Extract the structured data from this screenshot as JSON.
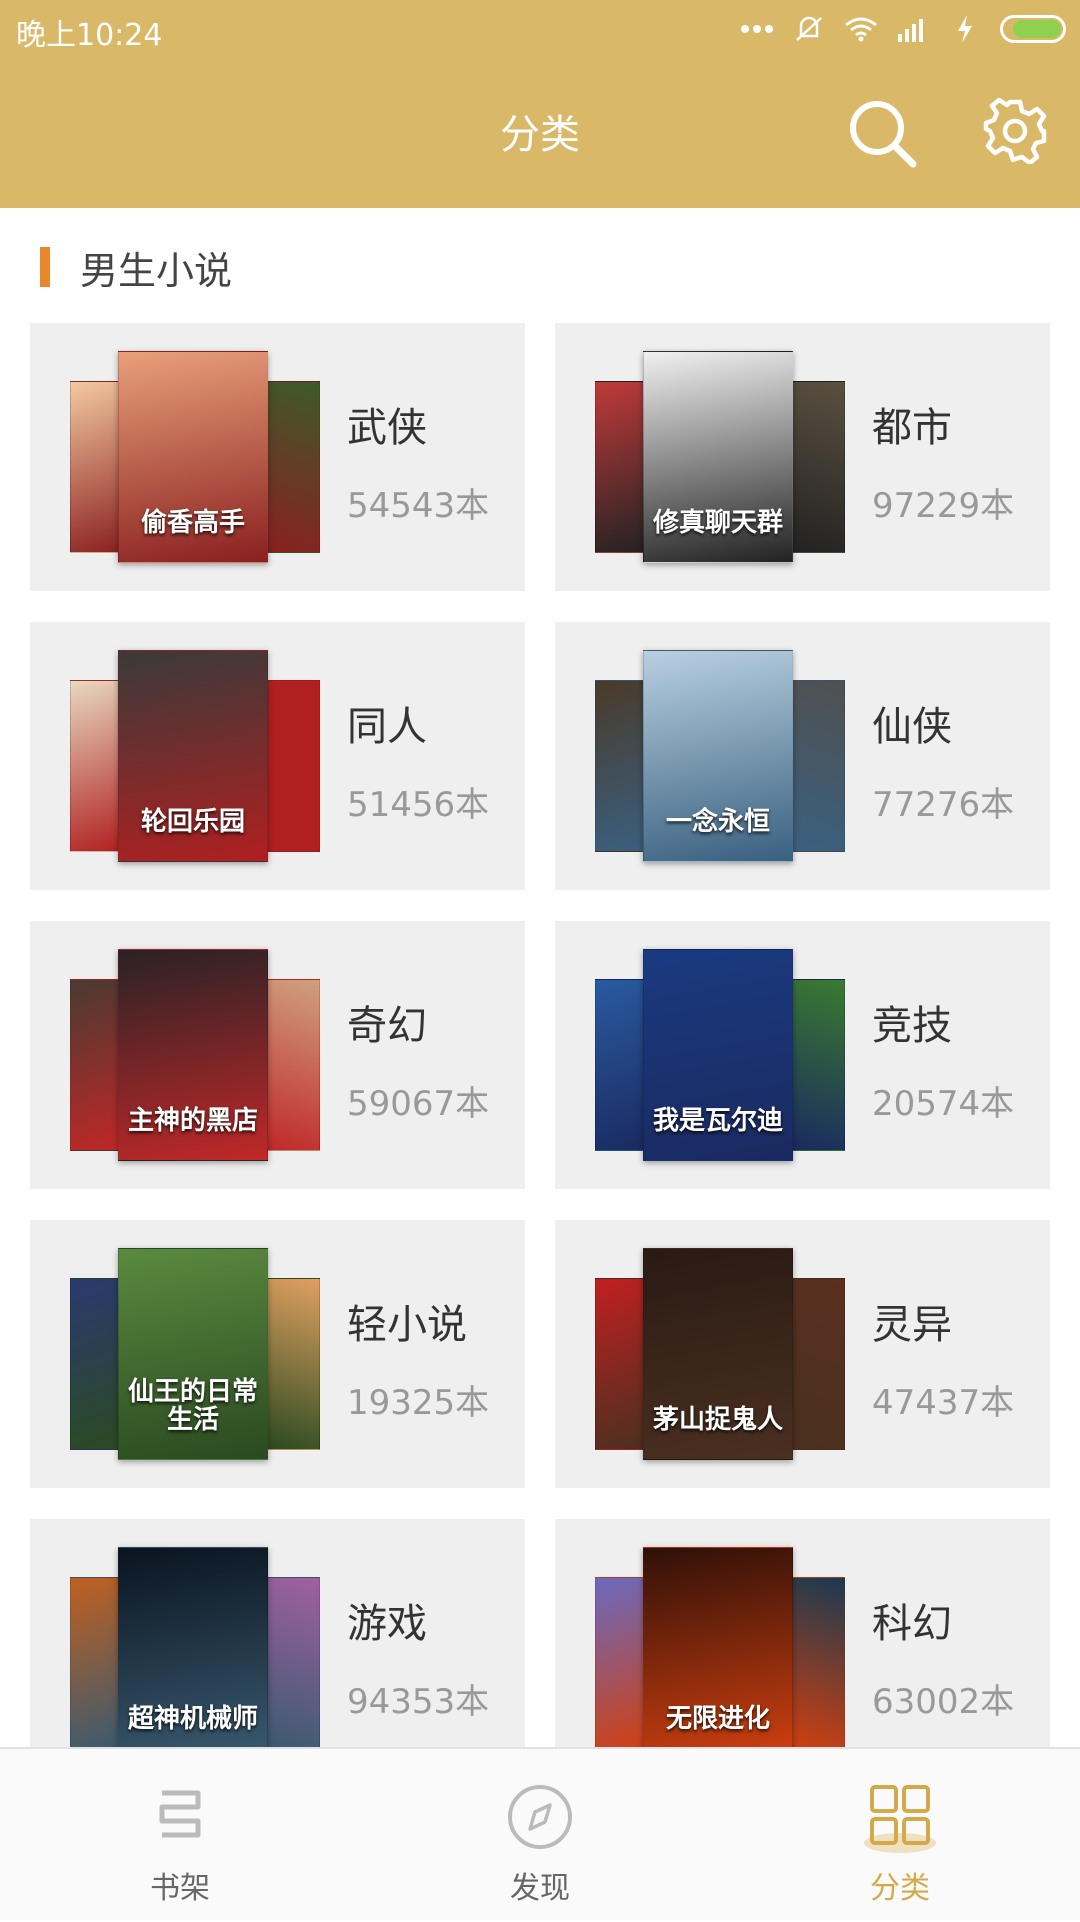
{
  "status": {
    "time": "晚上10:24",
    "battery_level": 0.85
  },
  "header": {
    "title": "分类",
    "search_icon": "search-icon",
    "settings_icon": "gear-icon"
  },
  "section": {
    "title": "男生小说"
  },
  "categories": [
    {
      "name": "武侠",
      "count": "54543本",
      "cover_text": "偷香高手",
      "colors": [
        "#e8a07a",
        "#8a2020",
        "#f3c9a0",
        "#3d5a2a"
      ]
    },
    {
      "name": "都市",
      "count": "97229本",
      "cover_text": "修真聊天群",
      "colors": [
        "#f0f0f0",
        "#222222",
        "#c03a3a",
        "#5a5040"
      ]
    },
    {
      "name": "同人",
      "count": "51456本",
      "cover_text": "轮回乐园",
      "colors": [
        "#3a3a3a",
        "#b02020",
        "#e8d8c0",
        "#b02020"
      ]
    },
    {
      "name": "仙侠",
      "count": "77276本",
      "cover_text": "一念永恒",
      "colors": [
        "#b8d0e0",
        "#3a6080",
        "#4a3a2a",
        "#505050"
      ]
    },
    {
      "name": "奇幻",
      "count": "59067本",
      "cover_text": "主神的黑店",
      "colors": [
        "#2a2226",
        "#c02828",
        "#4a3a30",
        "#d0a080"
      ]
    },
    {
      "name": "竞技",
      "count": "20574本",
      "cover_text": "我是瓦尔迪",
      "colors": [
        "#1a3a80",
        "#1a2a60",
        "#2a5aa0",
        "#3a7a30"
      ]
    },
    {
      "name": "轻小说",
      "count": "19325本",
      "cover_text": "仙王的日常生活",
      "colors": [
        "#5a8a40",
        "#2a4a20",
        "#2a3a70",
        "#e0a060"
      ]
    },
    {
      "name": "灵异",
      "count": "47437本",
      "cover_text": "茅山捉鬼人",
      "colors": [
        "#2a1a14",
        "#4a3020",
        "#c02020",
        "#5a3020"
      ]
    },
    {
      "name": "游戏",
      "count": "94353本",
      "cover_text": "超神机械师",
      "colors": [
        "#0a1420",
        "#3a5a70",
        "#c06020",
        "#a060a0"
      ]
    },
    {
      "name": "科幻",
      "count": "63002本",
      "cover_text": "无限进化",
      "colors": [
        "#301008",
        "#d04010",
        "#6a6ac0",
        "#1a3a50"
      ]
    }
  ],
  "tabs": [
    {
      "label": "书架",
      "icon": "bookshelf-icon"
    },
    {
      "label": "发现",
      "icon": "compass-icon"
    },
    {
      "label": "分类",
      "icon": "category-grid-icon",
      "active": true
    }
  ]
}
